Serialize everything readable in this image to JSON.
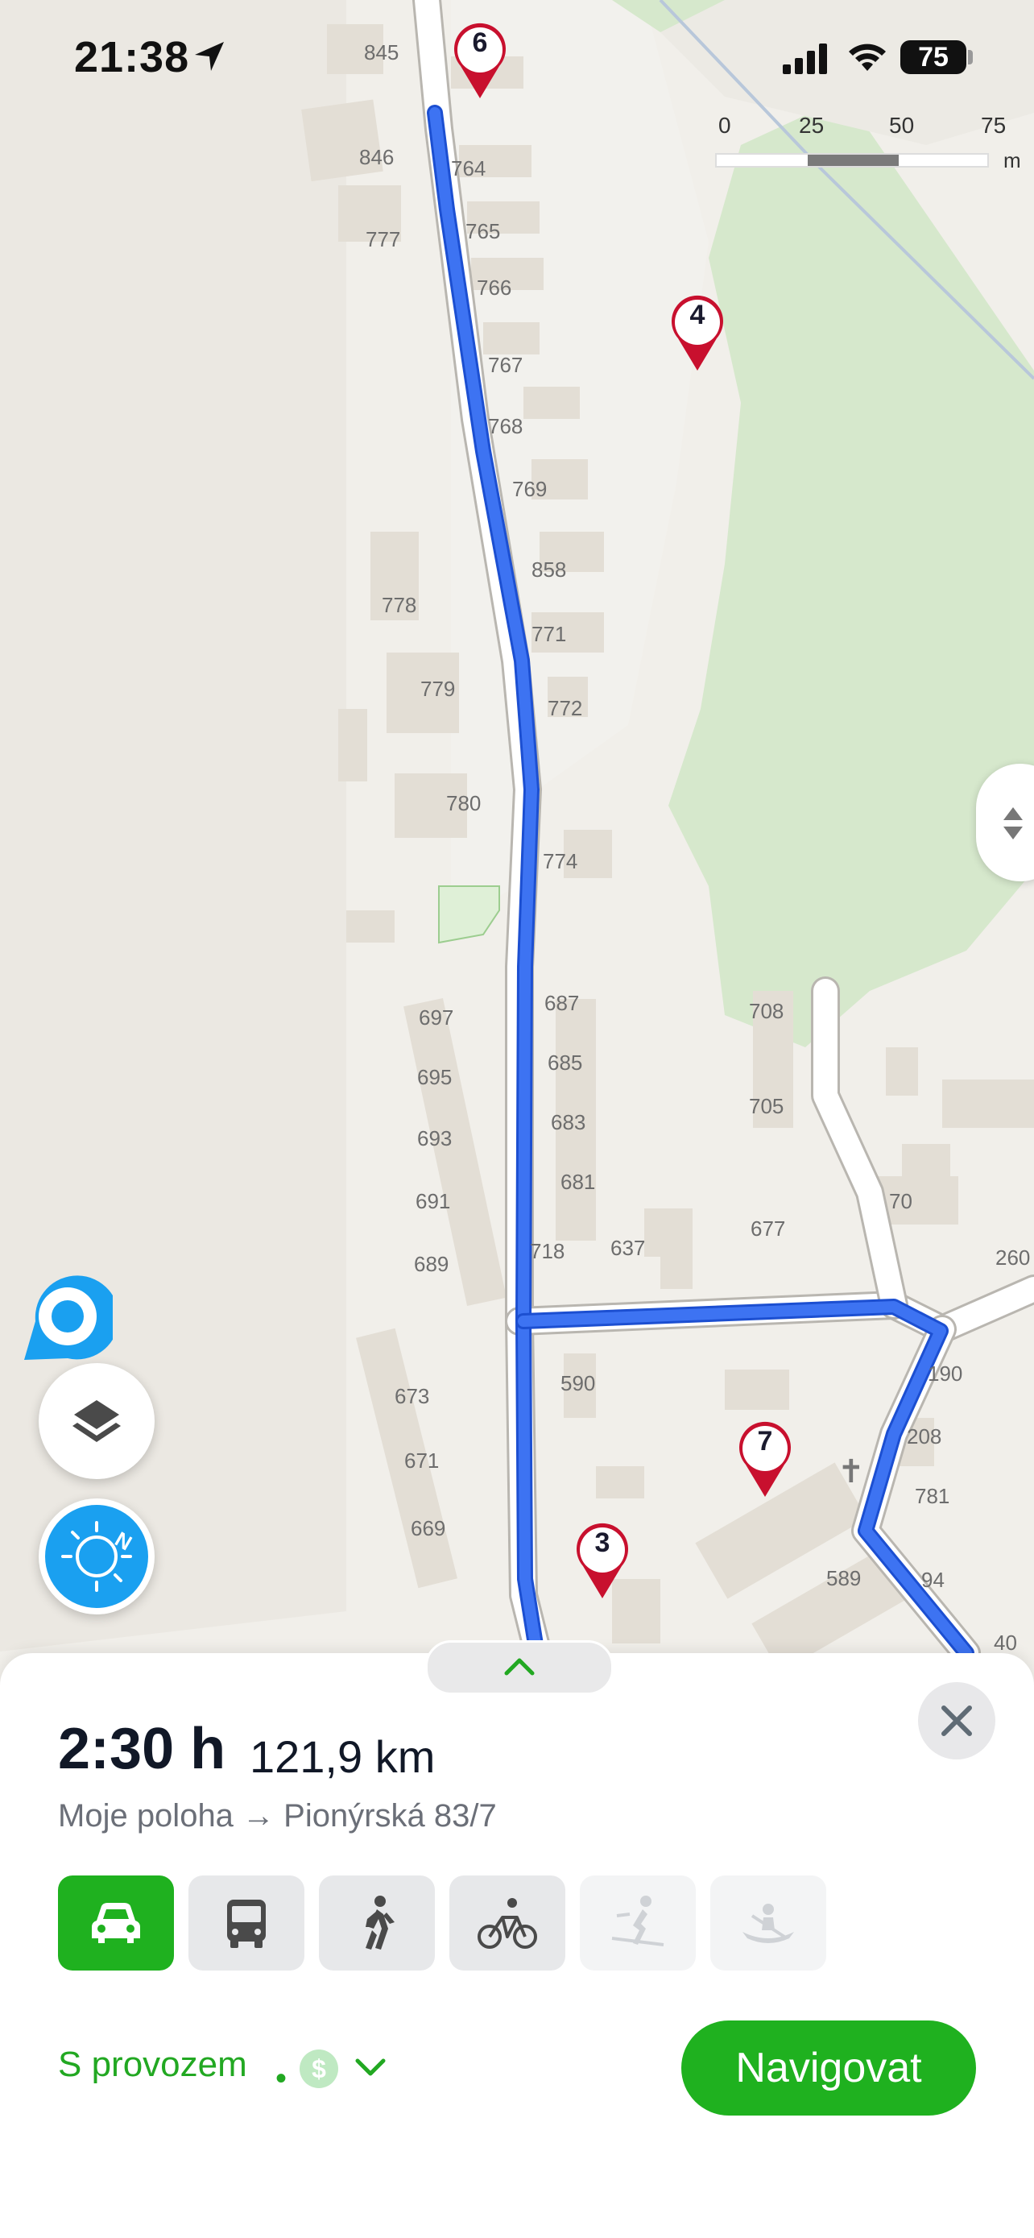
{
  "status_bar": {
    "time": "21:38",
    "battery": "75",
    "icons": [
      "location-arrow-icon",
      "cellular-signal-icon",
      "wifi-icon",
      "battery-icon"
    ]
  },
  "scale_bar": {
    "labels": [
      "0",
      "25",
      "50",
      "75"
    ],
    "unit": "m"
  },
  "map": {
    "waypoints": [
      {
        "label": "6"
      },
      {
        "label": "4"
      },
      {
        "label": "7"
      },
      {
        "label": "3"
      }
    ],
    "house_numbers": [
      "845",
      "846",
      "777",
      "764",
      "765",
      "766",
      "767",
      "768",
      "769",
      "858",
      "771",
      "772",
      "778",
      "779",
      "780",
      "774",
      "697",
      "695",
      "693",
      "691",
      "689",
      "687",
      "685",
      "683",
      "681",
      "718",
      "637",
      "708",
      "705",
      "677",
      "70",
      "260",
      "673",
      "671",
      "669",
      "590",
      "190",
      "208",
      "781",
      "589",
      "94",
      "40"
    ],
    "colors": {
      "route": "#3d73f2",
      "forest": "#d6e8cc",
      "background": "#f1efea",
      "pin": "#c8102e"
    }
  },
  "bottom_sheet": {
    "duration": "2:30 h",
    "distance": "121,9 km",
    "route_from_to": "Moje poloha → Pionýrská 83/7",
    "transport_modes": [
      {
        "icon": "car-icon",
        "state": "selected"
      },
      {
        "icon": "bus-icon",
        "state": "enabled"
      },
      {
        "icon": "walk-icon",
        "state": "enabled"
      },
      {
        "icon": "bicycle-icon",
        "state": "enabled"
      },
      {
        "icon": "ski-icon",
        "state": "disabled"
      },
      {
        "icon": "canoe-icon",
        "state": "disabled"
      }
    ],
    "traffic_option": "S provozem",
    "separator": "•",
    "toll_symbol": "$",
    "navigate_button": "Navigovat",
    "accent_color": "#1fb11f"
  }
}
